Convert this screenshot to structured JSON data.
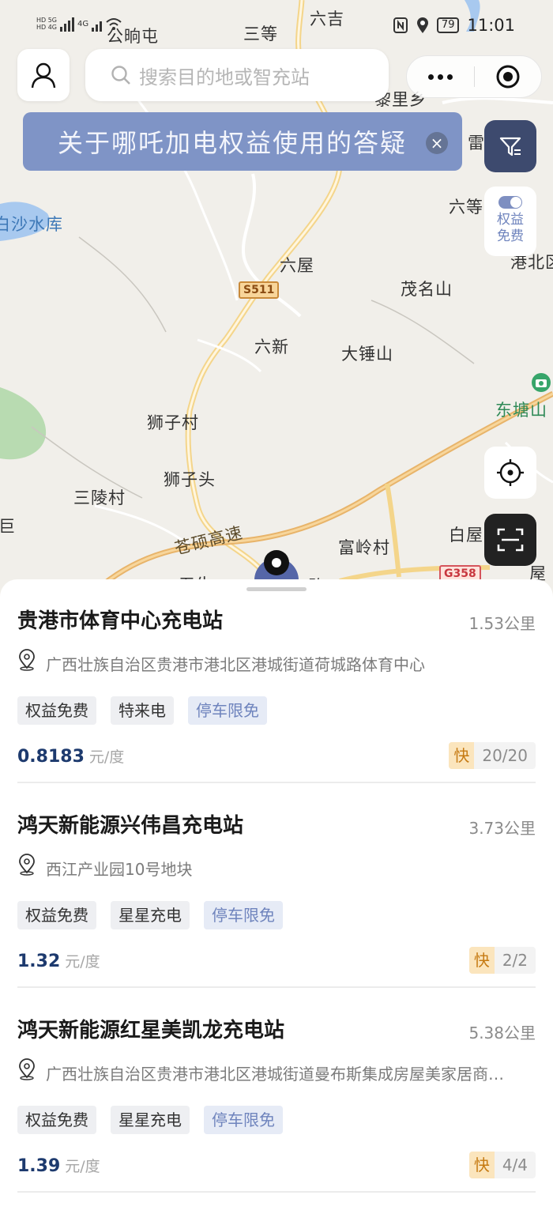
{
  "status_bar": {
    "time": "11:01",
    "battery": "79",
    "network": "4G"
  },
  "map": {
    "places": {
      "gongxiangtun": "公晌屯",
      "sandeng": "三等",
      "liuji": "六吉",
      "lixiang": "黎里乡",
      "lei": "雷",
      "baishashuiku": "白沙水库",
      "liudeng": "六等",
      "gangbei": "港北区",
      "liuwu": "六屋",
      "maomingshan": "茂名山",
      "liuxin": "六新",
      "dachuishan": "大锤山",
      "dongtangshan": "东塘山",
      "shizicun": "狮子村",
      "shizitou": "狮子头",
      "sanlingcun": "三陵村",
      "ju": "巨",
      "baiwu": "白屋",
      "fulingcun": "富岭村",
      "wusheng": "五牛",
      "wu2": "屋",
      "cangshuo": "苍硕高速",
      "lu": "路"
    },
    "road_shields": {
      "s511": "S511",
      "g358": "G358"
    }
  },
  "top": {
    "search_placeholder": "搜索目的地或智充站",
    "banner_text": "关于哪吒加电权益使用的答疑",
    "banner_close": "×",
    "rights_toggle_label_1": "权益",
    "rights_toggle_label_2": "免费"
  },
  "stations": [
    {
      "name": "贵港市体育中心充电站",
      "distance": "1.53公里",
      "address": "广西壮族自治区贵港市港北区港城街道荷城路体育中心",
      "tags": [
        "权益免费",
        "特来电",
        "停车限免"
      ],
      "price": "0.8183",
      "unit": "元/度",
      "fast_label": "快",
      "count": "20/20"
    },
    {
      "name": "鸿天新能源兴伟昌充电站",
      "distance": "3.73公里",
      "address": "西江产业园10号地块",
      "tags": [
        "权益免费",
        "星星充电",
        "停车限免"
      ],
      "price": "1.32",
      "unit": "元/度",
      "fast_label": "快",
      "count": "2/2"
    },
    {
      "name": "鸿天新能源红星美凯龙充电站",
      "distance": "5.38公里",
      "address": "广西壮族自治区贵港市港北区港城街道曼布斯集成房屋美家居商…",
      "tags": [
        "权益免费",
        "星星充电",
        "停车限免"
      ],
      "price": "1.39",
      "unit": "元/度",
      "fast_label": "快",
      "count": "4/4"
    }
  ],
  "colors": {
    "accent": "#7f94c6",
    "tag_blue_text": "#6f84bd",
    "price": "#1d3a6e",
    "fast_bg": "#fbe5bd",
    "filter_button": "#3d4a6e"
  }
}
